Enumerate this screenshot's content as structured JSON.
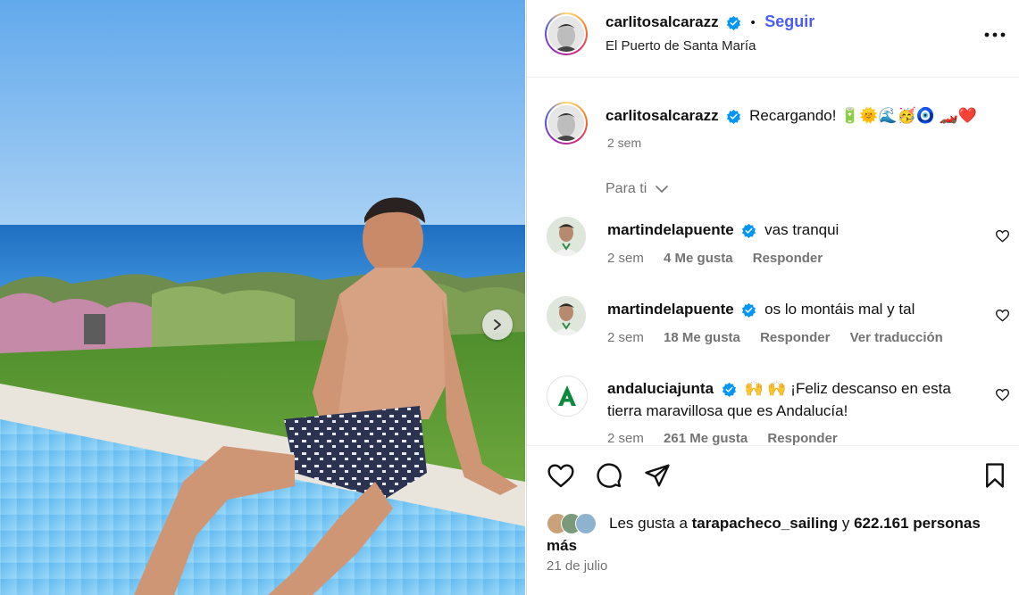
{
  "post": {
    "author": "carlitosalcarazz",
    "follow_label": "Seguir",
    "dot": "•",
    "location": "El Puerto de Santa María",
    "caption": "Recargando! 🔋🌞🌊🥳🧿 🏎️❤️",
    "caption_time": "2 sem",
    "for_you_label": "Para ti",
    "likes_prefix": "Les gusta a",
    "likes_user": "tarapacheco_sailing",
    "likes_connector": "y",
    "likes_count": "622.161 personas más",
    "date": "21 de julio"
  },
  "comments": [
    {
      "user": "martindelapuente",
      "text": "vas tranqui",
      "time": "2 sem",
      "likes": "4 Me gusta",
      "reply": "Responder",
      "translate": ""
    },
    {
      "user": "martindelapuente",
      "text": "os lo montáis mal y tal",
      "time": "2 sem",
      "likes": "18 Me gusta",
      "reply": "Responder",
      "translate": "Ver traducción"
    },
    {
      "user": "andaluciajunta",
      "text": "🙌 🙌 ¡Feliz descanso en esta tierra maravillosa que es Andalucía!",
      "time": "2 sem",
      "likes": "261 Me gusta",
      "reply": "Responder",
      "translate": ""
    }
  ],
  "colors": {
    "accent": "#4a5df9",
    "verified": "#0095f6",
    "meta": "#737373",
    "andalucia_green": "#0b8a3e"
  },
  "icons": [
    "more-options-icon",
    "verified-badge-icon",
    "chevron-down-icon",
    "heart-icon",
    "comment-icon",
    "share-icon",
    "bookmark-icon",
    "carousel-next-icon"
  ]
}
